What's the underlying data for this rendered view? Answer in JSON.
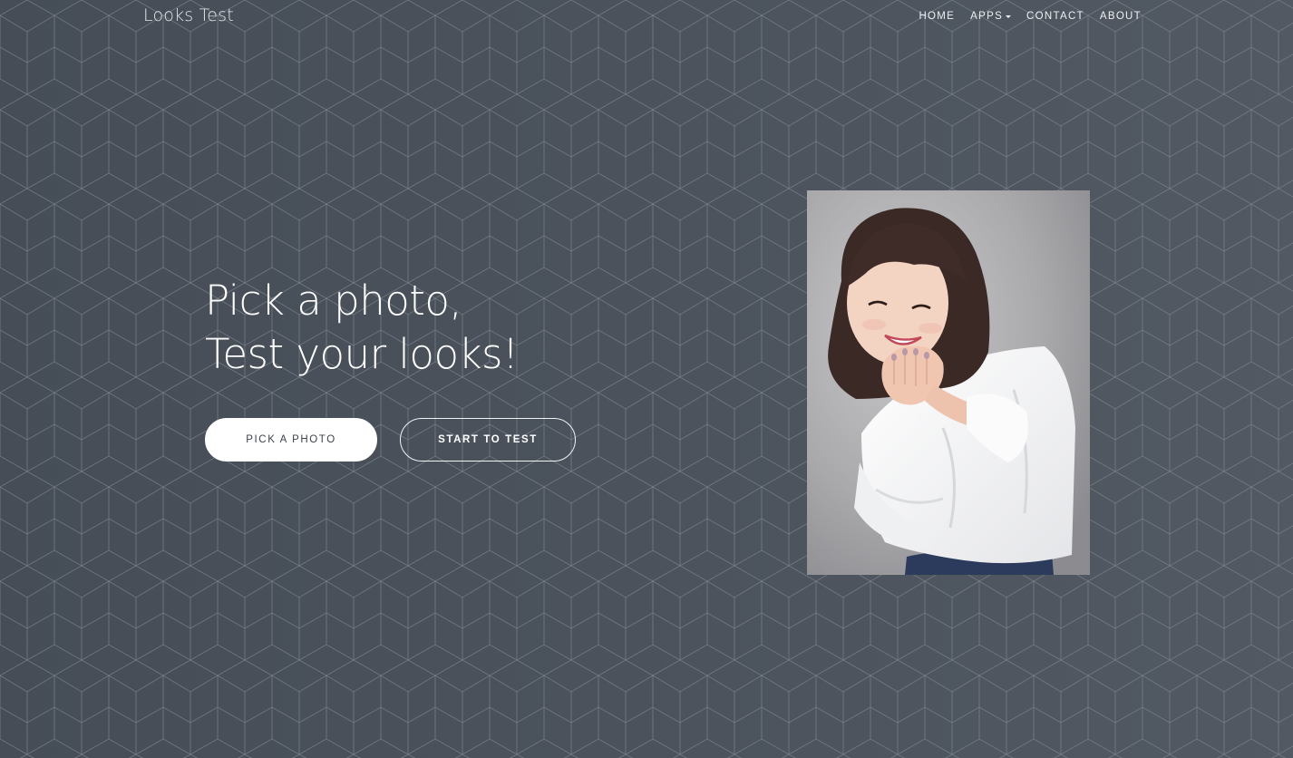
{
  "brand": {
    "name": "Looks Test"
  },
  "nav": {
    "home": "HOME",
    "apps": "APPS",
    "contact": "CONTACT",
    "about": "ABOUT"
  },
  "hero": {
    "line1": "Pick a photo,",
    "line2": "Test your looks!",
    "pick_button": "PICK A PHOTO",
    "test_button": "START TO TEST"
  },
  "colors": {
    "background": "#4a515b",
    "text": "#ffffff",
    "button_text_dark": "#3c434c"
  },
  "icons": {
    "apps_dropdown": "caret-down-icon"
  }
}
